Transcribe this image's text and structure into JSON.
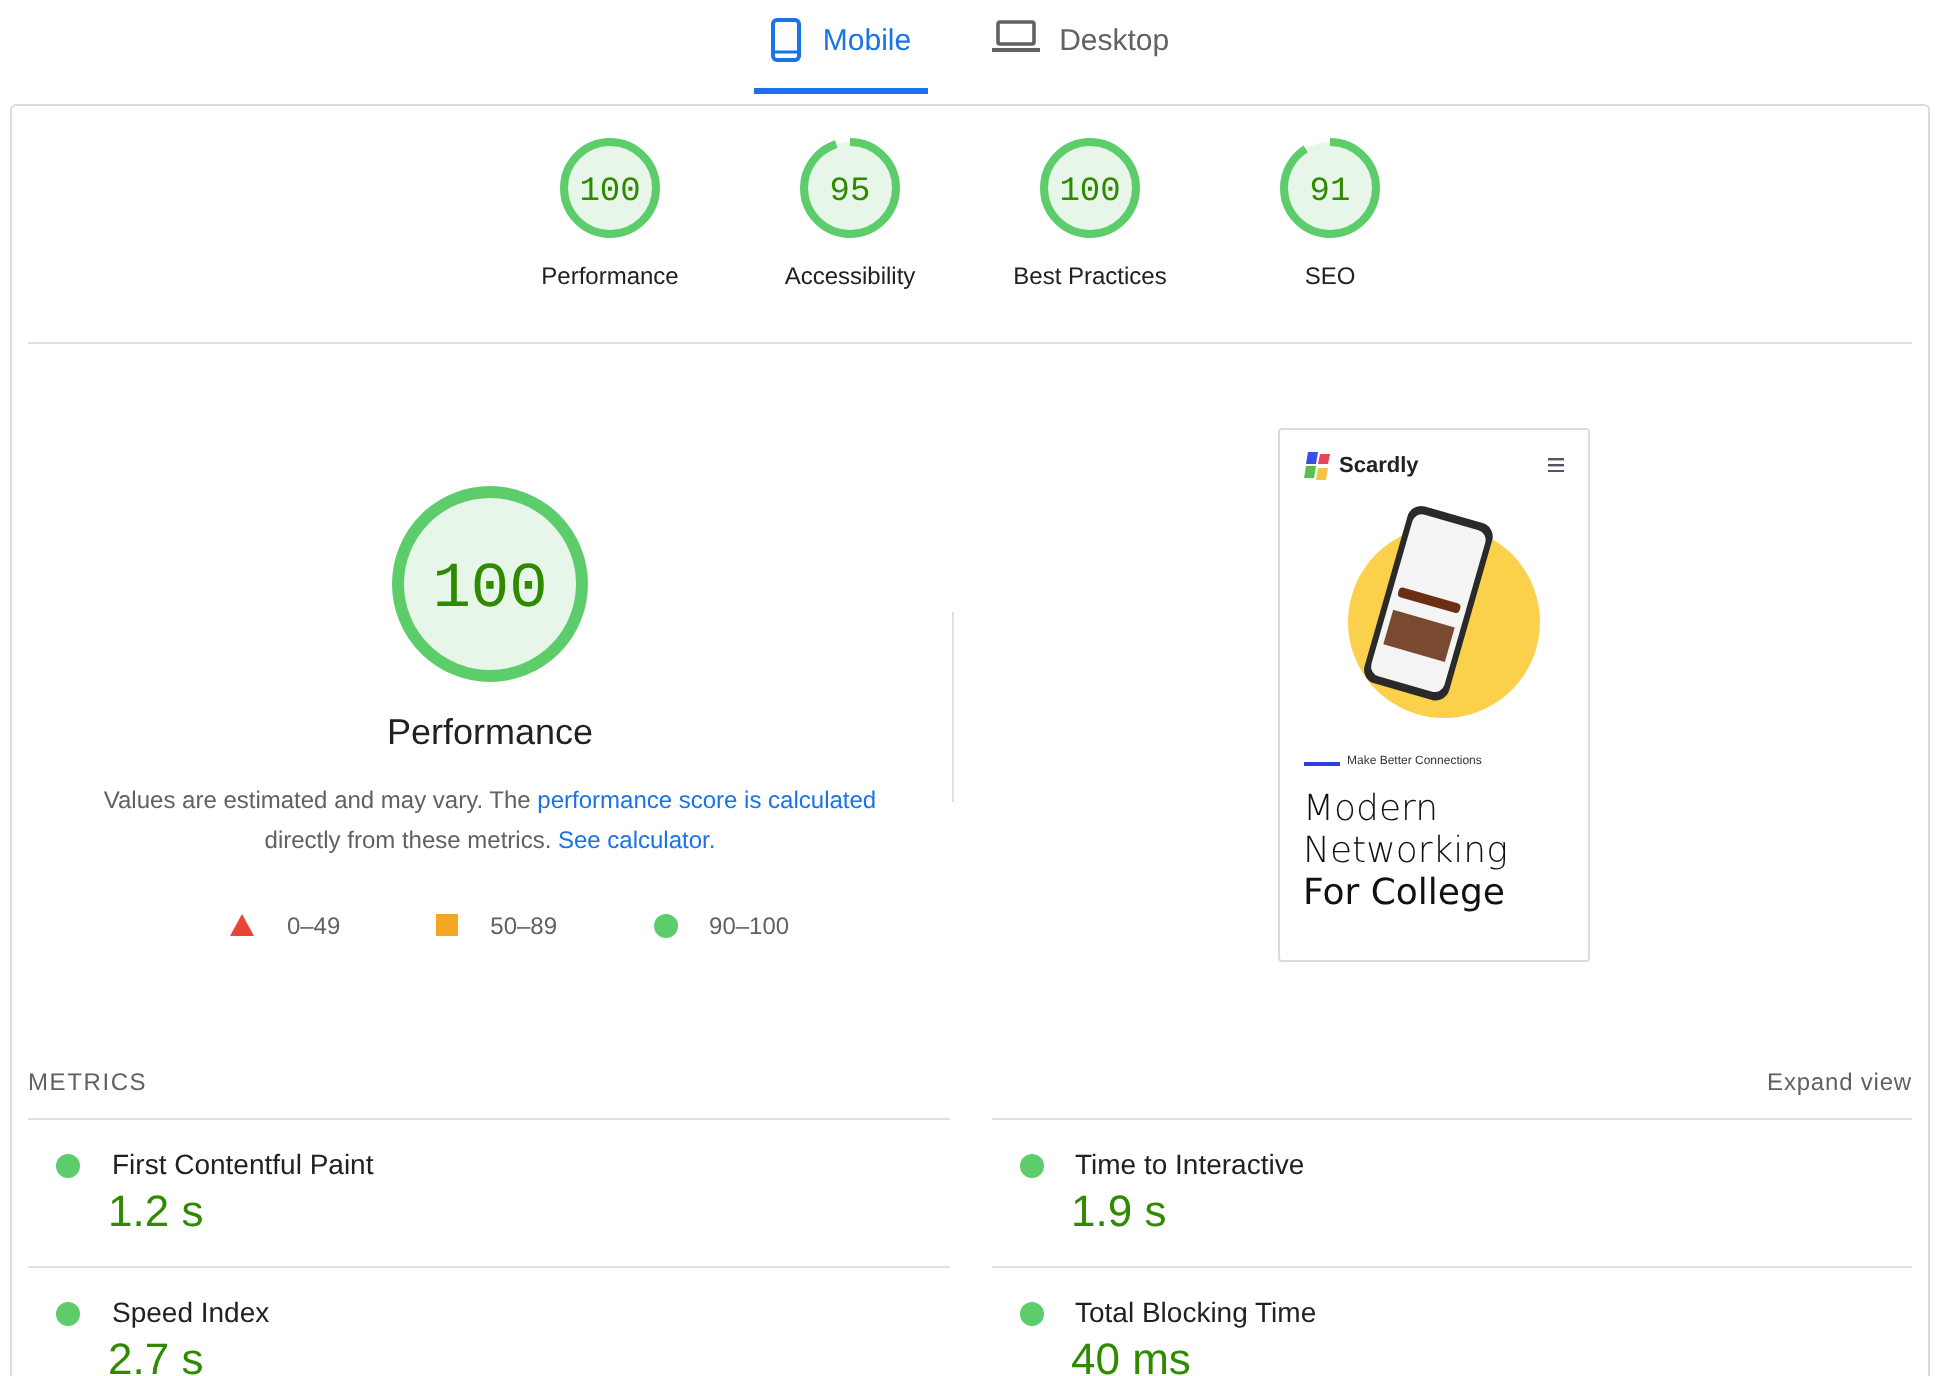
{
  "tabs": [
    {
      "label": "Mobile",
      "kind": "phone",
      "selected": true
    },
    {
      "label": "Desktop",
      "kind": "laptop",
      "selected": false
    }
  ],
  "categories": [
    {
      "score": "100",
      "label": "Performance",
      "level": 1
    },
    {
      "score": "95",
      "label": "Accessibility",
      "level": 0.95
    },
    {
      "score": "100",
      "label": "Best Practices",
      "level": 1
    },
    {
      "score": "91",
      "label": "SEO",
      "level": 0.91
    }
  ],
  "performance": {
    "score": "100",
    "level": 1,
    "title": "Performance",
    "description": [
      {
        "kind": "text",
        "text": "Values are estimated and may vary. The "
      },
      {
        "kind": "link",
        "text": "performance score is calculated"
      },
      {
        "kind": "text",
        "text": " directly from these metrics. "
      },
      {
        "kind": "link",
        "text": "See calculator."
      }
    ],
    "legend": [
      {
        "kind": "triangle",
        "range": "0–49",
        "color": "#eb4335"
      },
      {
        "kind": "square",
        "range": "50–89",
        "color": "#f5a623"
      },
      {
        "kind": "circle",
        "range": "90–100",
        "color": "#5ccd6a"
      }
    ]
  },
  "screenshot": {
    "brand": "Scardly",
    "tagline": "Make Better Connections",
    "heading": "Modern Networking **For College**"
  },
  "metrics": {
    "title": "METRICS",
    "expand": "Expand view",
    "items": [
      {
        "name": "First Contentful Paint",
        "value": "1.2 s",
        "color": "#5ccd6a"
      },
      {
        "name": "Time to Interactive",
        "value": "1.9 s",
        "color": "#5ccd6a"
      },
      {
        "name": "Speed Index",
        "value": "2.7 s",
        "color": "#5ccd6a"
      },
      {
        "name": "Total Blocking Time",
        "value": "40 ms",
        "color": "#5ccd6a"
      }
    ]
  }
}
